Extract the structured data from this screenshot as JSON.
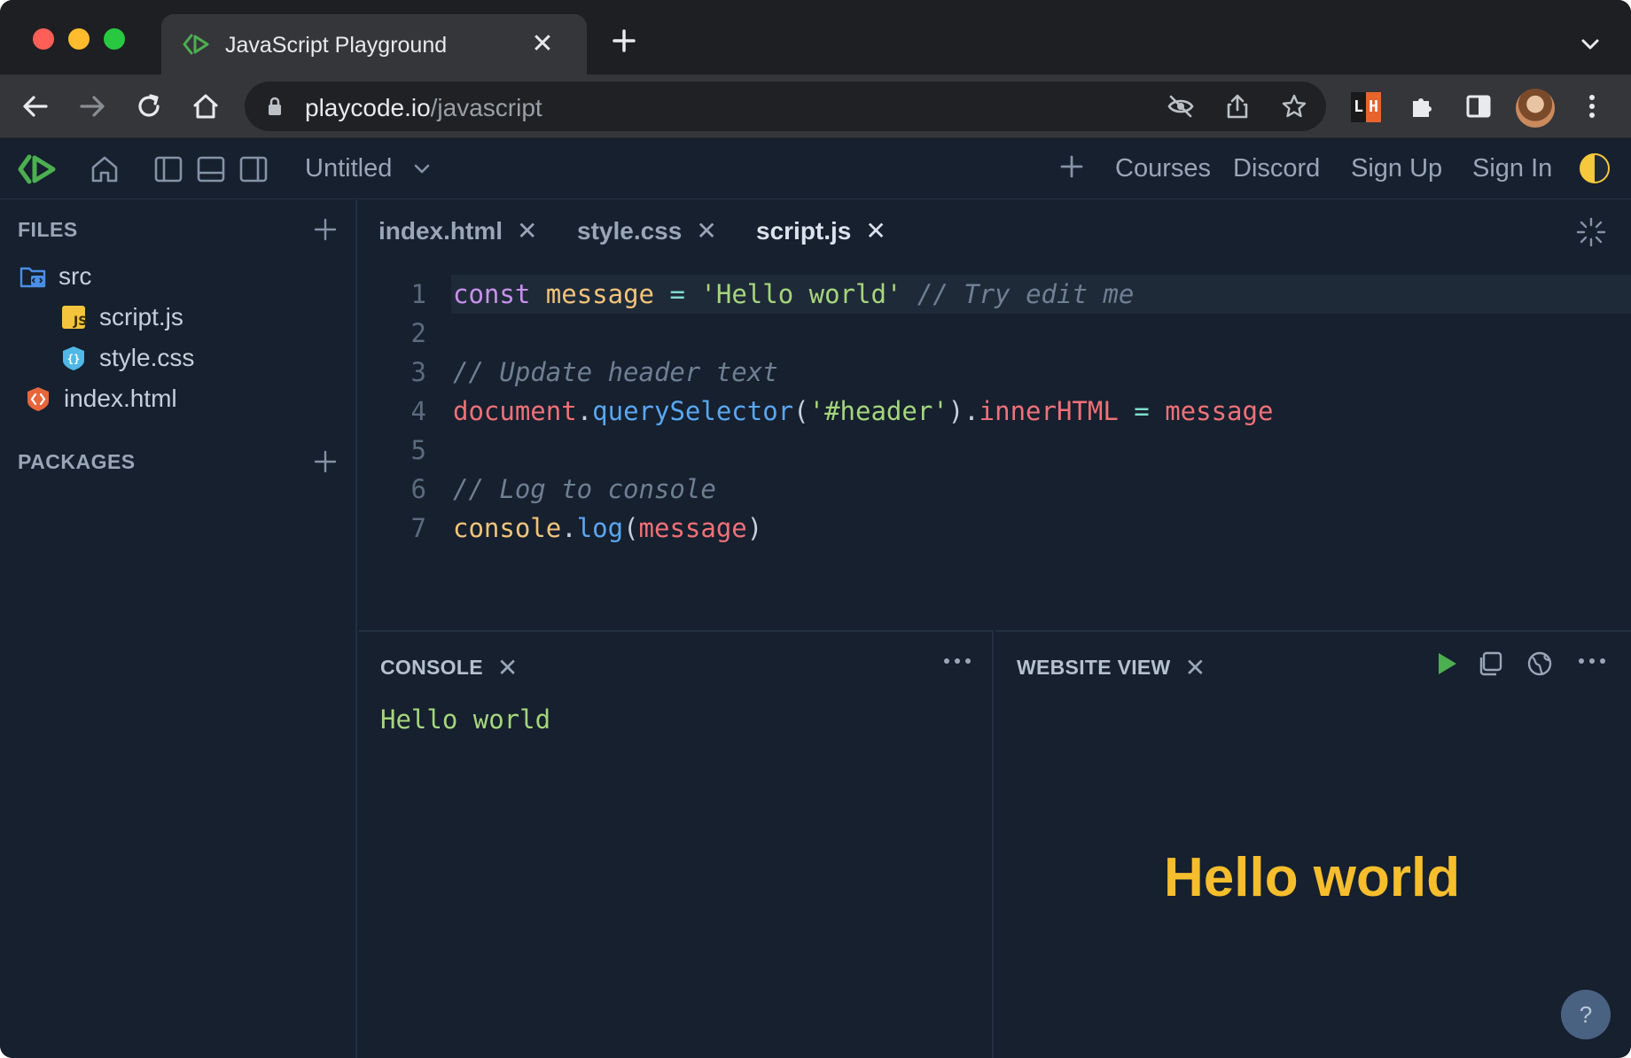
{
  "browser": {
    "tab_title": "JavaScript Playground",
    "url_host": "playcode.io",
    "url_path": "/javascript",
    "extension_lh": [
      "L",
      "H"
    ]
  },
  "app": {
    "project_title": "Untitled",
    "nav": {
      "courses": "Courses",
      "discord": "Discord",
      "sign_up": "Sign Up",
      "sign_in": "Sign In"
    }
  },
  "sidebar": {
    "files_heading": "FILES",
    "packages_heading": "PACKAGES",
    "tree": [
      {
        "label": "src",
        "icon": "folder-icon"
      },
      {
        "label": "script.js",
        "icon": "js-file-icon"
      },
      {
        "label": "style.css",
        "icon": "css-file-icon"
      },
      {
        "label": "index.html",
        "icon": "html-file-icon"
      }
    ]
  },
  "editor": {
    "tabs": [
      {
        "label": "index.html",
        "active": false
      },
      {
        "label": "style.css",
        "active": false
      },
      {
        "label": "script.js",
        "active": true
      }
    ],
    "line_numbers": [
      "1",
      "2",
      "3",
      "4",
      "5",
      "6",
      "7"
    ],
    "code": [
      [
        [
          "kw",
          "const"
        ],
        [
          "punc",
          " "
        ],
        [
          "var",
          "message"
        ],
        [
          "punc",
          " "
        ],
        [
          "op",
          "="
        ],
        [
          "punc",
          " "
        ],
        [
          "str",
          "'Hello world'"
        ],
        [
          "punc",
          " "
        ],
        [
          "cm",
          "// Try edit me"
        ]
      ],
      [],
      [
        [
          "cm",
          "// Update header text"
        ]
      ],
      [
        [
          "obj",
          "document"
        ],
        [
          "punc",
          "."
        ],
        [
          "fn",
          "querySelector"
        ],
        [
          "punc",
          "("
        ],
        [
          "str",
          "'#header'"
        ],
        [
          "punc",
          ")."
        ],
        [
          "prop",
          "innerHTML"
        ],
        [
          "punc",
          " "
        ],
        [
          "op",
          "="
        ],
        [
          "punc",
          " "
        ],
        [
          "prop",
          "message"
        ]
      ],
      [],
      [
        [
          "cm",
          "// Log to console"
        ]
      ],
      [
        [
          "var",
          "console"
        ],
        [
          "punc",
          "."
        ],
        [
          "fn",
          "log"
        ],
        [
          "punc",
          "("
        ],
        [
          "prop",
          "message"
        ],
        [
          "punc",
          ")"
        ]
      ]
    ]
  },
  "console": {
    "title": "CONSOLE",
    "output": "Hello world"
  },
  "website_view": {
    "title": "WEBSITE VIEW",
    "heading": "Hello world",
    "help": "?"
  },
  "colors": {
    "app_bg": "#16202e",
    "accent_green": "#4caf50",
    "heading_yellow": "#f6be2c",
    "console_green": "#a5d67c"
  }
}
